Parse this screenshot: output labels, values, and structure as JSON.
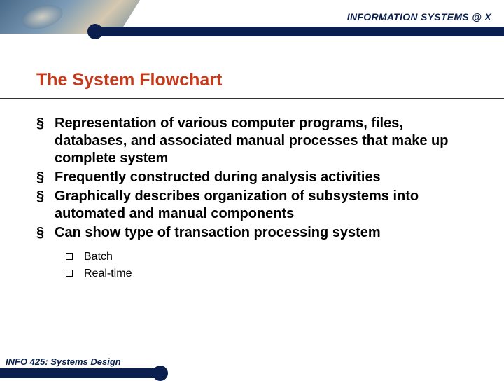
{
  "header": {
    "label": "INFORMATION SYSTEMS @ X"
  },
  "title": "The System Flowchart",
  "bullets": [
    "Representation of various computer programs, files, databases, and associated manual processes that make up complete system",
    "Frequently constructed during analysis activities",
    "Graphically describes organization of subsystems into automated and manual components",
    "Can show type of transaction processing system"
  ],
  "sub_bullets": [
    "Batch",
    "Real-time"
  ],
  "footer": {
    "label": "INFO 425: Systems Design"
  }
}
